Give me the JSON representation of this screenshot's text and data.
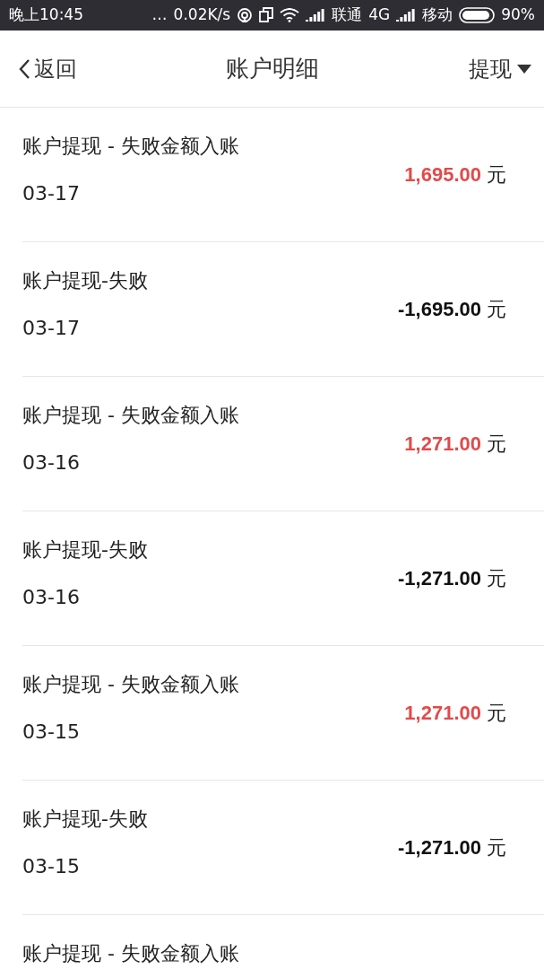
{
  "status_bar": {
    "time": "晚上10:45",
    "dots": "…",
    "speed": "0.02K/s",
    "carrier_1": "联通",
    "network": "4G",
    "carrier_2": "移动",
    "battery": "90%"
  },
  "header": {
    "back": "返回",
    "title": "账户明细",
    "filter": "提现"
  },
  "records": [
    {
      "title": "账户提现 - 失败金额入账",
      "date": "03-17",
      "amount": "1,695.00",
      "unit": "元",
      "kind": "income"
    },
    {
      "title": "账户提现-失败",
      "date": "03-17",
      "amount": "-1,695.00",
      "unit": "元",
      "kind": "expense"
    },
    {
      "title": "账户提现 - 失败金额入账",
      "date": "03-16",
      "amount": "1,271.00",
      "unit": "元",
      "kind": "income"
    },
    {
      "title": "账户提现-失败",
      "date": "03-16",
      "amount": "-1,271.00",
      "unit": "元",
      "kind": "expense"
    },
    {
      "title": "账户提现 - 失败金额入账",
      "date": "03-15",
      "amount": "1,271.00",
      "unit": "元",
      "kind": "income"
    },
    {
      "title": "账户提现-失败",
      "date": "03-15",
      "amount": "-1,271.00",
      "unit": "元",
      "kind": "expense"
    },
    {
      "title": "账户提现 - 失败金额入账"
    }
  ]
}
